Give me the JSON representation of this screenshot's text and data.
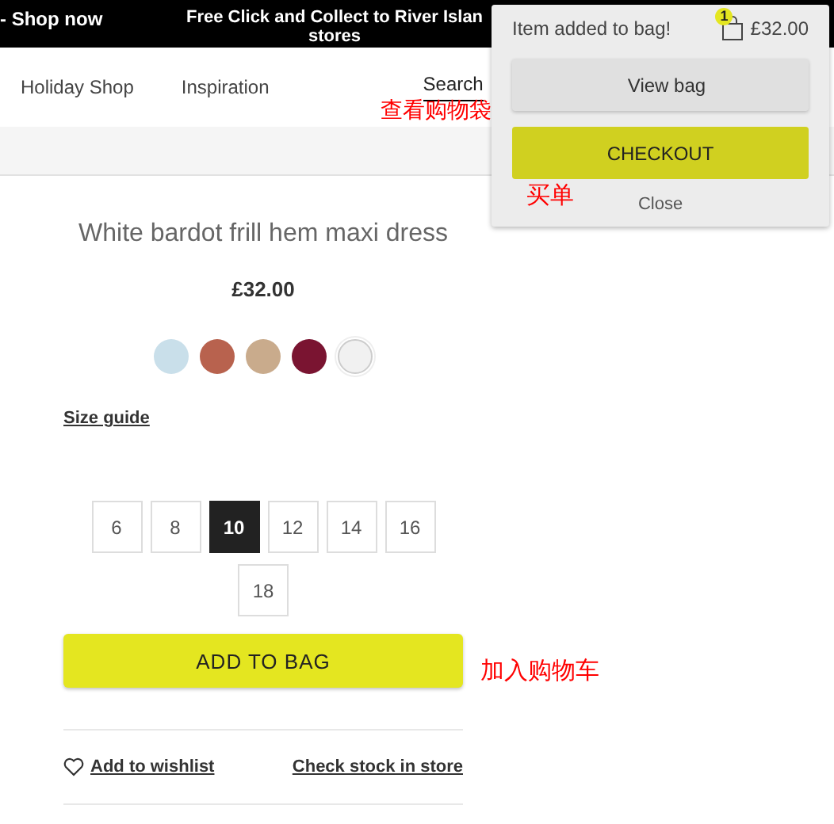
{
  "banner": {
    "left": "- Shop now",
    "center": "Free Click and Collect to River Islan",
    "center_line_2": "stores"
  },
  "nav": {
    "items": [
      "Holiday Shop",
      "Inspiration"
    ],
    "search": "Search"
  },
  "product": {
    "title": "White bardot frill hem maxi dress",
    "price": "£32.00",
    "swatches": [
      {
        "color": "#c9dfea",
        "selected": false
      },
      {
        "color": "#b8624e",
        "selected": false
      },
      {
        "color": "#c9ab8c",
        "selected": false
      },
      {
        "color": "#7a1431",
        "selected": false
      },
      {
        "color": "#f1f1f1",
        "selected": true
      }
    ],
    "size_guide": "Size guide",
    "sizes": [
      {
        "label": "6",
        "selected": false
      },
      {
        "label": "8",
        "selected": false
      },
      {
        "label": "10",
        "selected": true
      },
      {
        "label": "12",
        "selected": false
      },
      {
        "label": "14",
        "selected": false
      },
      {
        "label": "16",
        "selected": false
      },
      {
        "label": "18",
        "selected": false
      }
    ],
    "add_to_bag": "ADD TO BAG",
    "wishlist": "Add to wishlist",
    "check_stock": "Check stock in store"
  },
  "bag_popup": {
    "message": "Item added to bag!",
    "count": "1",
    "total": "£32.00",
    "view_bag": "View bag",
    "checkout": "CHECKOUT",
    "close": "Close"
  },
  "annotations": [
    {
      "text": "查看购物袋",
      "kind": "view_bag"
    },
    {
      "text": "买单",
      "kind": "checkout"
    },
    {
      "text": "加入购物车",
      "kind": "add_to_bag"
    }
  ]
}
